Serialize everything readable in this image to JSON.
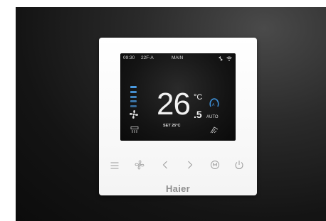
{
  "status_bar": {
    "time": "09:30",
    "code": "22F-A",
    "mode": "MAIN"
  },
  "display": {
    "temperature_integer": "26",
    "temperature_decimal": ".5",
    "temperature_unit": "°C",
    "set_temperature": "SET 25°C",
    "mode_label": "AUTO",
    "fan_level_total": 5,
    "fan_level_active": 5
  },
  "buttons": [
    {
      "icon": "menu-icon"
    },
    {
      "icon": "fan-icon"
    },
    {
      "icon": "chevron-left-icon"
    },
    {
      "icon": "chevron-right-icon"
    },
    {
      "icon": "mode-icon"
    },
    {
      "icon": "power-icon"
    }
  ],
  "brand": {
    "name": "Haier"
  },
  "colors": {
    "accent_blue": "#3d8fd6",
    "fan_bar_active": "#4a9ae0",
    "fan_bar_dim": "#5a6f86",
    "button_icon": "#9a9a9a"
  }
}
